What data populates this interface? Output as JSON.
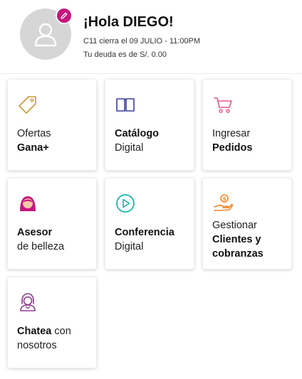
{
  "header": {
    "greeting": "¡Hola DIEGO!",
    "cycle_text": "C11 cierra el 09 JULIO - 11:00PM",
    "debt_text": "Tu deuda es de S/. 0.00"
  },
  "tiles": [
    {
      "line1": "Ofertas",
      "line2": "Gana+",
      "icon": "tag-icon"
    },
    {
      "line1": "Catálogo",
      "line2": "Digital",
      "icon": "book-icon"
    },
    {
      "line1": "Ingresar",
      "line2": "Pedidos",
      "icon": "cart-icon"
    },
    {
      "line1": "Asesor",
      "line2": "de belleza",
      "icon": "beauty-advisor-icon"
    },
    {
      "line1": "Conferencia",
      "line2": "Digital",
      "icon": "play-icon"
    },
    {
      "line1": "Gestionar",
      "line2": "Clientes y",
      "line3": "cobranzas",
      "icon": "hand-coin-icon"
    },
    {
      "line1": "Chatea",
      "line1b": " con",
      "line2": "nosotros",
      "icon": "chat-agent-icon"
    }
  ],
  "colors": {
    "accent_magenta": "#c5167f",
    "icon_gold": "#c79a3a",
    "icon_indigo": "#3b3fa0",
    "icon_pink": "#e05a86",
    "icon_teal": "#18b3a8",
    "icon_orange": "#f0872a",
    "icon_purple": "#8a3c8f"
  }
}
